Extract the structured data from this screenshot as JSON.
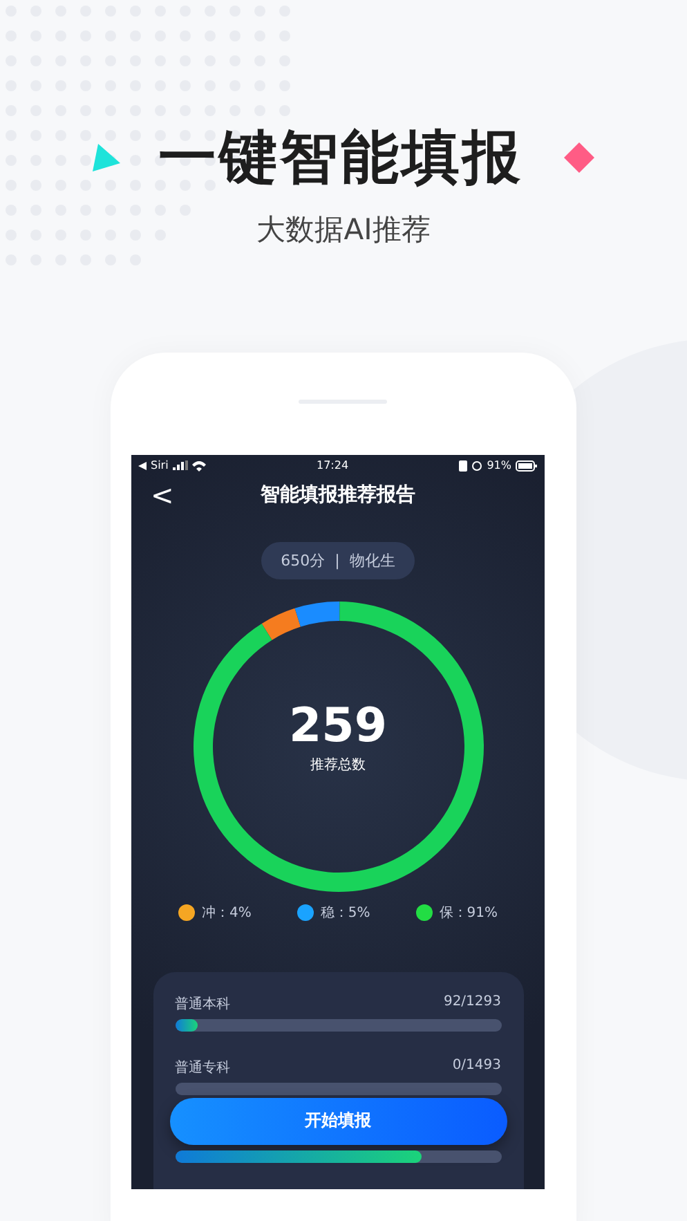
{
  "headline": {
    "title": "一键智能填报",
    "subtitle": "大数据AI推荐"
  },
  "status_bar": {
    "carrier": "Siri",
    "time": "17:24",
    "battery": "91%"
  },
  "nav": {
    "back": "<",
    "title": "智能填报推荐报告"
  },
  "summary_tag": {
    "score": "650分",
    "separator": "|",
    "subjects": "物化生"
  },
  "donut": {
    "total": "259",
    "caption": "推荐总数",
    "chart_data": {
      "type": "donut",
      "values": [
        4,
        5,
        91
      ]
    }
  },
  "legend": [
    {
      "label": "冲：4%",
      "color": "#f5a623"
    },
    {
      "label": "稳：5%",
      "color": "#1aa3ff"
    },
    {
      "label": "保：91%",
      "color": "#22dd44"
    }
  ],
  "progress_rows": [
    {
      "label": "普通本科",
      "count": "92/1293",
      "level": 0.07
    },
    {
      "label": "普通专科",
      "count": "0/1493"
    },
    {
      "level": 0.755
    }
  ],
  "start_button": "开始填报"
}
